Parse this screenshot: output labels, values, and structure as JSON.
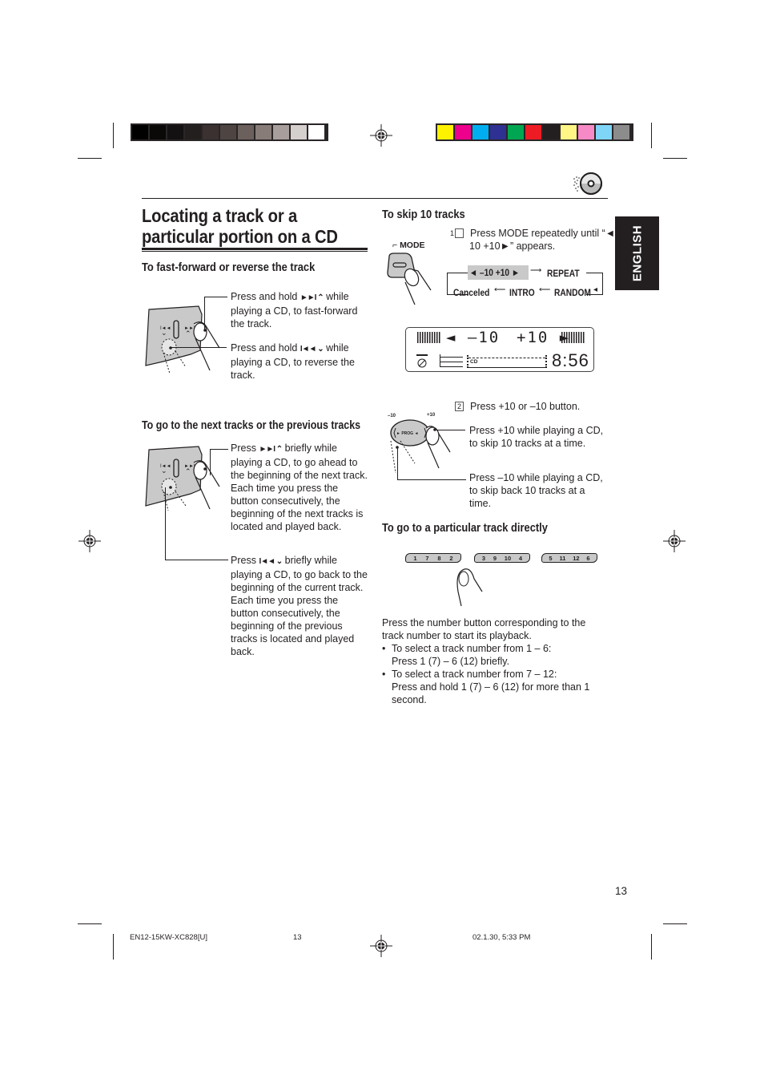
{
  "print_marks": {
    "gray_swatches": [
      "#000000",
      "#0b0908",
      "#141112",
      "#231f1e",
      "#3b3130",
      "#4e4543",
      "#6b605c",
      "#877c78",
      "#a89f9c",
      "#d5cfce",
      "#ffffff"
    ],
    "color_swatches": [
      "#fff200",
      "#ec008c",
      "#00aeef",
      "#2e3192",
      "#00a651",
      "#ed1c24",
      "#231f20",
      "#fff685",
      "#f68ac6",
      "#7fd5f7",
      "#8c8c8c"
    ]
  },
  "side_tab": {
    "label": "ENGLISH"
  },
  "page_title": "Locating a track or a particular portion on a CD",
  "sections": {
    "fast_forward": {
      "heading": "To fast-forward or reverse the track",
      "forward_callout": {
        "pre": "Press and hold",
        "icons": "►►I ⌃",
        "post": "while playing a CD, to fast-forward the track."
      },
      "reverse_callout": {
        "pre": "Press and hold",
        "icons": "I◄◄ ⌄",
        "post": "while playing a CD, to reverse the track."
      }
    },
    "next_prev": {
      "heading": "To go to the next tracks or the previous tracks",
      "next_callout": {
        "pre": "Press",
        "icons": "►►I ⌃",
        "post": "briefly while playing a CD, to go ahead to the beginning of the next track. Each time you press the button consecutively, the beginning of the next tracks is located and played back."
      },
      "prev_callout": {
        "pre": "Press",
        "icons": "I◄◄ ⌄",
        "post": "briefly while playing a CD, to go back to the beginning of the current track. Each time you press the button consecutively, the beginning of the previous tracks is located and played back."
      }
    },
    "skip10": {
      "heading": "To skip 10 tracks",
      "mode_label": "MODE",
      "step1_num": "1",
      "step1_text": "Press MODE repeatedly until “◄–10  +10►” appears.",
      "flow": {
        "highlight": "◄ –10  +10 ►",
        "repeat": "REPEAT",
        "random": "RANDOM",
        "intro": "INTRO",
        "canceled": "Canceled"
      },
      "lcd": {
        "left": "◄ –10",
        "right": "+10 ►",
        "cd": "CD",
        "time": "8:56"
      },
      "step2_num": "2",
      "step2_text": "Press +10 or –10 button.",
      "button_labels": {
        "minus": "–10",
        "plus": "+10",
        "prog": "PROG"
      },
      "plus_callout": "Press +10 while playing a CD, to skip 10 tracks at a time.",
      "minus_callout": "Press –10 while playing a CD, to skip back 10 tracks at a time."
    },
    "direct": {
      "heading": "To go to a particular track directly",
      "buttons": [
        [
          "1",
          "7",
          "8",
          "2"
        ],
        [
          "3",
          "9",
          "10",
          "4"
        ],
        [
          "5",
          "11",
          "12",
          "6"
        ]
      ],
      "intro": "Press the number button corresponding to the track number to start its playback.",
      "bullets": [
        {
          "line1": "To select a track number from 1 – 6:",
          "line2": "Press 1 (7) – 6 (12) briefly."
        },
        {
          "line1": "To select a track number from 7 – 12:",
          "line2": "Press and hold 1 (7) – 6 (12) for more than 1 second."
        }
      ]
    }
  },
  "page_number": "13",
  "footer": {
    "code": "EN12-15KW-XC828[U]",
    "page": "13",
    "datetime": "02.1.30, 5:33 PM"
  }
}
